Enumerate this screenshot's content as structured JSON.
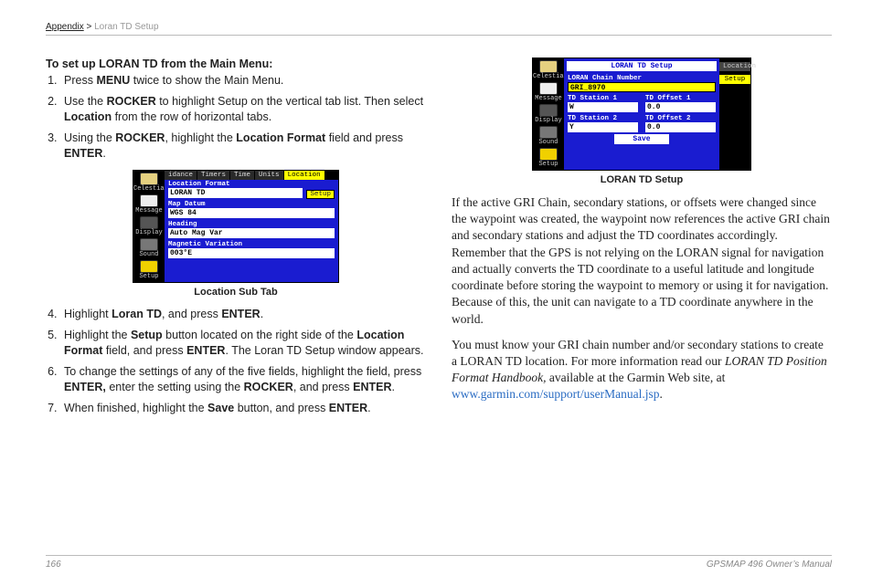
{
  "header": {
    "appendix": "Appendix",
    "sep": " > ",
    "sub": "Loran TD Setup"
  },
  "left": {
    "heading": "To set up LORAN TD from the Main Menu:",
    "steps_a": [
      {
        "pre": "Press ",
        "b1": "MENU",
        "post": " twice to show the Main Menu."
      },
      {
        "pre": "Use the ",
        "b1": "ROCKER",
        "mid": " to highlight Setup on the vertical tab list. Then select ",
        "b2": "Location",
        "post": " from the row of horizontal tabs."
      },
      {
        "pre": "Using the ",
        "b1": "ROCKER",
        "mid": ", highlight the ",
        "b2": "Location Format",
        "mid2": " field and press ",
        "b3": "ENTER",
        "post": "."
      }
    ],
    "caption1": "Location Sub Tab",
    "steps_b_start": 4,
    "steps_b": [
      {
        "pre": "Highlight ",
        "b1": "Loran TD",
        "mid": ", and press ",
        "b2": "ENTER",
        "post": "."
      },
      {
        "pre": "Highlight the ",
        "b1": "Setup",
        "mid": " button located on the right side of the ",
        "b2": "Location Format",
        "mid2": " field, and press ",
        "b3": "ENTER",
        "post": ". The Loran TD Setup window appears."
      },
      {
        "pre": "To change the settings of any of the five fields, highlight the field, press ",
        "b1": "ENTER,",
        "mid": " enter the setting using the ",
        "b2": "ROCKER",
        "mid2": ", and press ",
        "b3": "ENTER",
        "post": "."
      },
      {
        "pre": "When finished, highlight the ",
        "b1": "Save",
        "mid": " button, and press ",
        "b2": "ENTER",
        "post": "."
      }
    ]
  },
  "screen1": {
    "side": [
      "Celestial",
      "Message",
      "Display",
      "Sound",
      "Setup"
    ],
    "tabs": [
      "idance",
      "Timers",
      "Time",
      "Units",
      "Location"
    ],
    "rtab": "Setup",
    "rows": [
      {
        "label": "Location Format",
        "value": "LORAN TD"
      },
      {
        "label": "Map Datum",
        "value": "WGS 84"
      },
      {
        "label": "Heading",
        "value": "Auto Mag Var"
      },
      {
        "label": "Magnetic Variation",
        "value": "003°E"
      }
    ]
  },
  "screen2": {
    "side": [
      "Celestial",
      "Message",
      "Display",
      "Sound",
      "Setup"
    ],
    "title": "LORAN TD Setup",
    "rtab_a": "Location",
    "rtab_b": "Setup",
    "chain_lbl": "LORAN Chain Number",
    "chain_val": "GRI_8970",
    "td1a": "TD Station 1",
    "td1b": "TD Offset 1",
    "td1av": "W",
    "td1bv": "0.0",
    "td2a": "TD Station 2",
    "td2b": "TD Offset 2",
    "td2av": "Y",
    "td2bv": "0.0",
    "save": "Save"
  },
  "caption2": "LORAN TD Setup",
  "right": {
    "p1": "If the active GRI Chain, secondary stations, or offsets were changed since the waypoint was created, the waypoint now references the active GRI chain and secondary stations and adjust the TD coordinates accordingly. Remember that the GPS is not relying on the LORAN signal for navigation and actually converts the TD coordinate to a useful latitude and longitude coordinate before storing the waypoint to memory or using it for navigation. Because of this, the unit can navigate to a TD coordinate anywhere in the world.",
    "p2a": "You must know your GRI chain number and/or secondary stations to create a LORAN TD location. For more information read our ",
    "p2i": "LORAN TD Position Format Handbook,",
    "p2b": " available at the Garmin Web site, at ",
    "p2link": "www.garmin.com/support/userManual.jsp",
    "p2c": "."
  },
  "footer": {
    "page": "166",
    "manual": "GPSMAP 496 Owner’s Manual"
  }
}
